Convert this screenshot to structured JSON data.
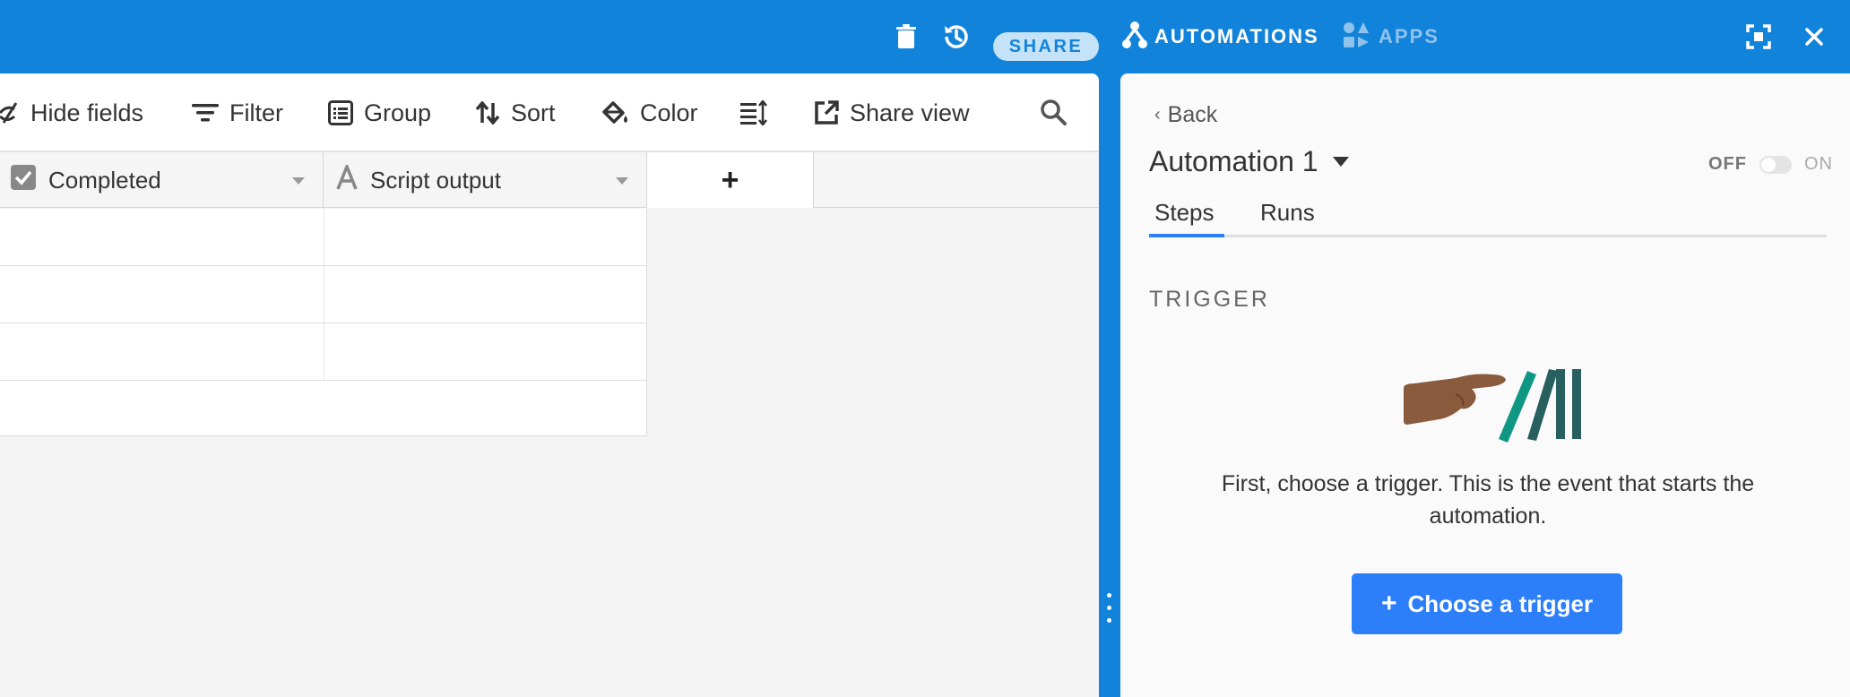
{
  "topbar": {
    "share_label": "SHARE",
    "automations_label": "AUTOMATIONS",
    "apps_label": "APPS",
    "icons": [
      "trash-icon",
      "history-icon",
      "automations-icon",
      "apps-icon",
      "expand-icon",
      "close-icon"
    ]
  },
  "toolbar": {
    "hide_fields": "Hide fields",
    "filter": "Filter",
    "group": "Group",
    "sort": "Sort",
    "color": "Color",
    "share_view": "Share view"
  },
  "grid": {
    "columns": [
      {
        "name": "Completed",
        "type": "checkbox"
      },
      {
        "name": "Script output",
        "type": "text"
      }
    ],
    "add_column_label": "+",
    "row_count": 3
  },
  "automation": {
    "back_label": "Back",
    "back_chevron": "‹",
    "title": "Automation 1",
    "toggle_off": "OFF",
    "toggle_on": "ON",
    "toggle_state": "off",
    "tabs": [
      {
        "label": "Steps",
        "active": true
      },
      {
        "label": "Runs",
        "active": false
      }
    ],
    "section_label": "TRIGGER",
    "description": "First, choose a trigger. This is the event that starts the automation.",
    "button_plus": "+",
    "button_label": "Choose a trigger"
  },
  "colors": {
    "brand_blue": "#1283da",
    "button_blue": "#2d7ff9",
    "domino_teal": "#0f9784",
    "domino_dark": "#27605f",
    "hand": "#8a5a3c"
  }
}
